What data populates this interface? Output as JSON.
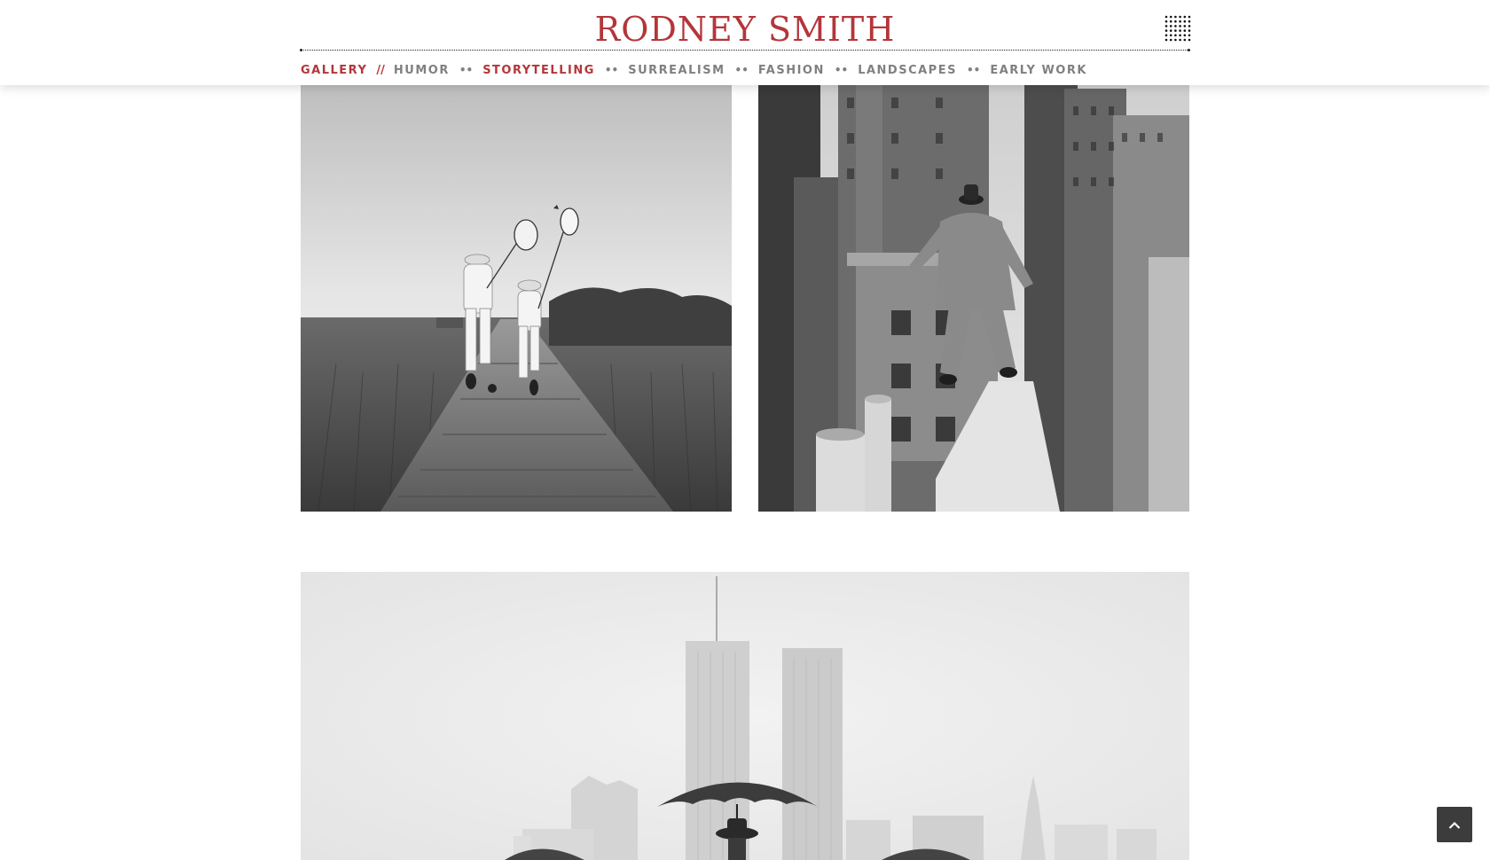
{
  "header": {
    "site_title": "RODNEY SMITH",
    "menu_icon": "grid-dots-icon",
    "brand_color": "#b3363b"
  },
  "nav": {
    "items": [
      {
        "label": "GALLERY",
        "active": true
      },
      {
        "label": "HUMOR",
        "active": false
      },
      {
        "label": "STORYTELLING",
        "active": true
      },
      {
        "label": "SURREALISM",
        "active": false
      },
      {
        "label": "FASHION",
        "active": false
      },
      {
        "label": "LANDSCAPES",
        "active": false
      },
      {
        "label": "EARLY WORK",
        "active": false
      }
    ],
    "divider": "//",
    "separator": "••"
  },
  "gallery": {
    "photos": [
      {
        "subject": "two figures with butterfly nets running on a boardwalk"
      },
      {
        "subject": "man in suit leaping from a rooftop ledge"
      },
      {
        "subject": "figures with umbrellas before a city skyline"
      }
    ]
  },
  "back_to_top": {
    "icon": "chevron-up-icon"
  }
}
